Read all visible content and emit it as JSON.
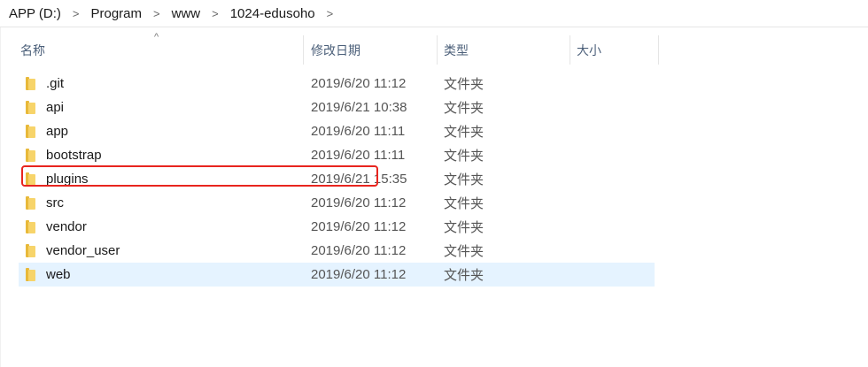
{
  "breadcrumb": {
    "items": [
      "APP (D:)",
      "Program",
      "www",
      "1024-edusoho"
    ],
    "separator": ">"
  },
  "columns": {
    "name": "名称",
    "date": "修改日期",
    "type": "类型",
    "size": "大小",
    "sort_indicator": "^"
  },
  "files": [
    {
      "name": ".git",
      "modified": "2019/6/20 11:12",
      "type": "文件夹"
    },
    {
      "name": "api",
      "modified": "2019/6/21 10:38",
      "type": "文件夹"
    },
    {
      "name": "app",
      "modified": "2019/6/20 11:11",
      "type": "文件夹"
    },
    {
      "name": "bootstrap",
      "modified": "2019/6/20 11:11",
      "type": "文件夹"
    },
    {
      "name": "plugins",
      "modified": "2019/6/21 15:35",
      "type": "文件夹"
    },
    {
      "name": "src",
      "modified": "2019/6/20 11:12",
      "type": "文件夹"
    },
    {
      "name": "vendor",
      "modified": "2019/6/20 11:12",
      "type": "文件夹"
    },
    {
      "name": "vendor_user",
      "modified": "2019/6/20 11:12",
      "type": "文件夹"
    },
    {
      "name": "web",
      "modified": "2019/6/20 11:12",
      "type": "文件夹"
    }
  ],
  "selected_file": "web",
  "highlighted_file": "plugins",
  "colors": {
    "highlight_border": "#e8251f",
    "selection_bg": "#e5f3ff",
    "folder": "#f7d46a"
  }
}
